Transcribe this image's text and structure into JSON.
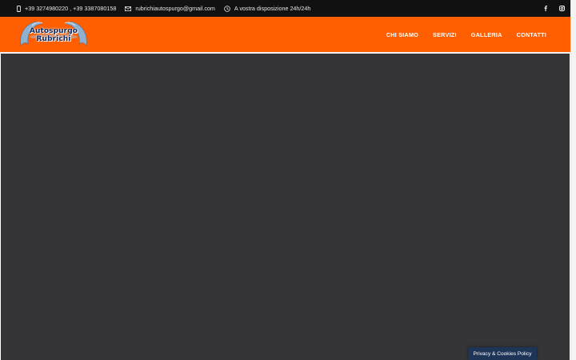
{
  "topbar": {
    "phone": "+39 3274980220 , +39 3387080158",
    "email": "rubrichiautospurgo@gmail.com",
    "hours": "A vostra disposizione 24h/24h",
    "icons": {
      "phone": "mobile-phone-icon",
      "email": "envelope-icon",
      "hours": "clock-icon"
    },
    "social": [
      "facebook-icon",
      "instagram-icon"
    ]
  },
  "header": {
    "logo": {
      "line1": "Autospurgo",
      "line2": "Rubrichi"
    },
    "nav": [
      {
        "label": "CHI SIAMO"
      },
      {
        "label": "SERVIZI"
      },
      {
        "label": "GALLERIA"
      },
      {
        "label": "CONTATTI"
      }
    ]
  },
  "cookie": {
    "label": "Privacy & Cookies Policy"
  },
  "colors": {
    "topbar_bg": "#111111",
    "header_bg": "#ff5f00",
    "main_bg": "#353538",
    "cookie_bg": "#1f3558"
  }
}
